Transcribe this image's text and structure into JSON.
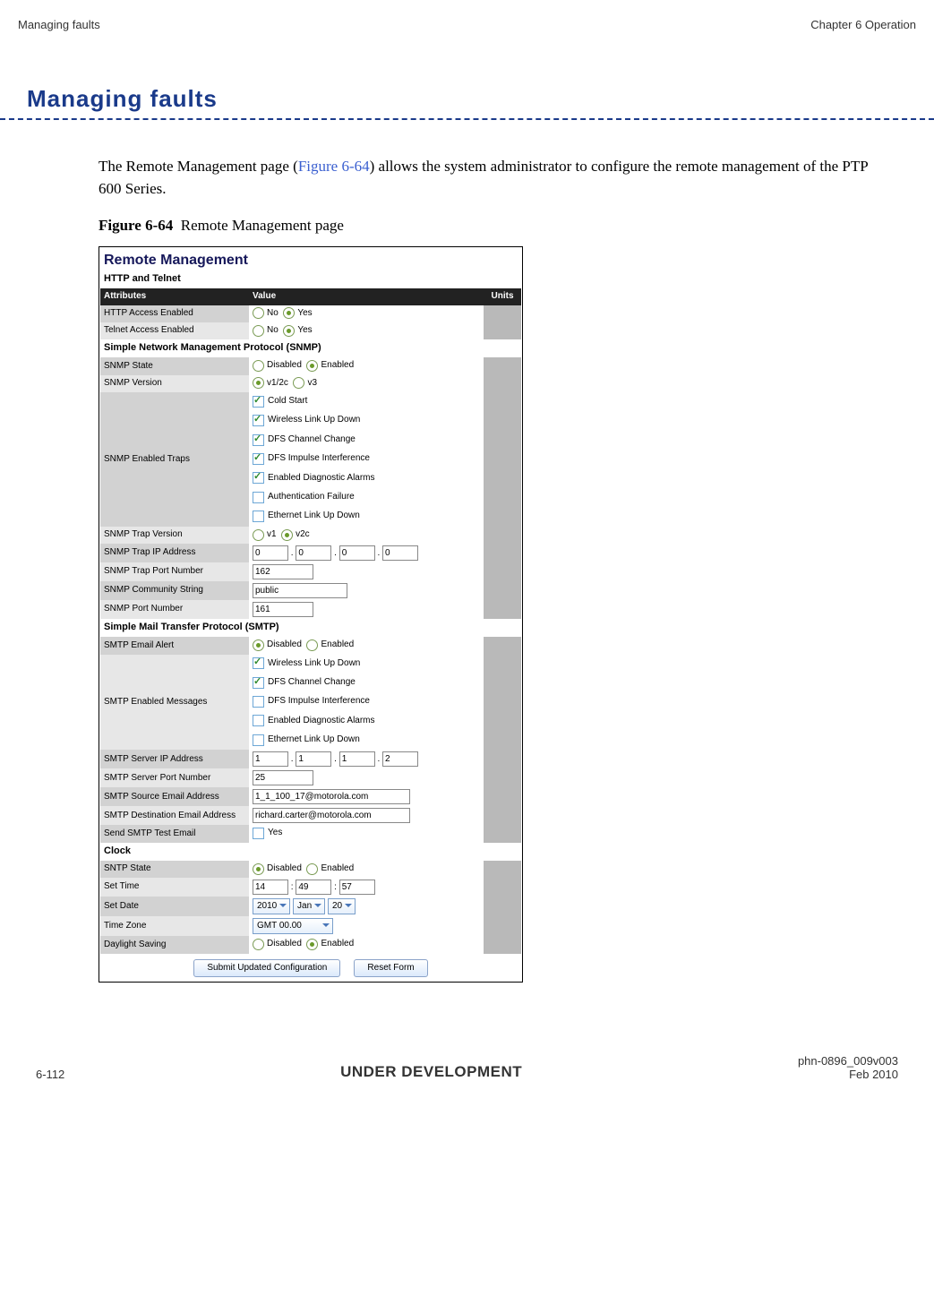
{
  "header": {
    "left": "Managing faults",
    "right": "Chapter 6 Operation"
  },
  "title": "Managing faults",
  "intro": {
    "part1": "The Remote Management page (",
    "figref": "Figure 6-64",
    "part2": ") allows the system administrator to configure the remote management of the PTP 600 Series."
  },
  "caption": {
    "label": "Figure 6-64",
    "text": "Remote Management page"
  },
  "figure": {
    "heading": "Remote Management",
    "sections": {
      "http": "HTTP and Telnet",
      "snmp": "Simple Network Management Protocol (SNMP)",
      "smtp": "Simple Mail Transfer Protocol (SMTP)",
      "clock": "Clock"
    },
    "colhead": {
      "attr": "Attributes",
      "val": "Value",
      "units": "Units"
    },
    "rows": {
      "http_access": {
        "label": "HTTP Access Enabled",
        "opt_no": "No",
        "opt_yes": "Yes"
      },
      "telnet_access": {
        "label": "Telnet Access Enabled",
        "opt_no": "No",
        "opt_yes": "Yes"
      },
      "snmp_state": {
        "label": "SNMP State",
        "opt_dis": "Disabled",
        "opt_en": "Enabled"
      },
      "snmp_version": {
        "label": "SNMP Version",
        "opt_v12c": "v1/2c",
        "opt_v3": "v3"
      },
      "snmp_traps": {
        "label": "SNMP Enabled Traps",
        "opts": {
          "cold": "Cold Start",
          "wlud": "Wireless Link Up Down",
          "dfscc": "DFS Channel Change",
          "dfsii": "DFS Impulse Interference",
          "eda": "Enabled Diagnostic Alarms",
          "authf": "Authentication Failure",
          "elud": "Ethernet Link Up Down"
        }
      },
      "snmp_trap_ver": {
        "label": "SNMP Trap Version",
        "opt_v1": "v1",
        "opt_v2c": "v2c"
      },
      "snmp_trap_ip": {
        "label": "SNMP Trap IP Address",
        "a": "0",
        "b": "0",
        "c": "0",
        "d": "0"
      },
      "snmp_trap_port": {
        "label": "SNMP Trap Port Number",
        "val": "162"
      },
      "snmp_comm": {
        "label": "SNMP Community String",
        "val": "public"
      },
      "snmp_port": {
        "label": "SNMP Port Number",
        "val": "161"
      },
      "smtp_alert": {
        "label": "SMTP Email Alert",
        "opt_dis": "Disabled",
        "opt_en": "Enabled"
      },
      "smtp_msgs": {
        "label": "SMTP Enabled Messages",
        "opts": {
          "wlud": "Wireless Link Up Down",
          "dfscc": "DFS Channel Change",
          "dfsii": "DFS Impulse Interference",
          "eda": "Enabled Diagnostic Alarms",
          "elud": "Ethernet Link Up Down"
        }
      },
      "smtp_ip": {
        "label": "SMTP Server IP Address",
        "a": "1",
        "b": "1",
        "c": "1",
        "d": "2"
      },
      "smtp_port": {
        "label": "SMTP Server Port Number",
        "val": "25"
      },
      "smtp_src": {
        "label": "SMTP Source Email Address",
        "val": "1_1_100_17@motorola.com"
      },
      "smtp_dst": {
        "label": "SMTP Destination Email Address",
        "val": "richard.carter@motorola.com"
      },
      "smtp_test": {
        "label": "Send SMTP Test Email",
        "opt": "Yes"
      },
      "sntp_state": {
        "label": "SNTP State",
        "opt_dis": "Disabled",
        "opt_en": "Enabled"
      },
      "set_time": {
        "label": "Set Time",
        "h": "14",
        "m": "49",
        "s": "57"
      },
      "set_date": {
        "label": "Set Date",
        "y": "2010",
        "mo": "Jan",
        "d": "20"
      },
      "tz": {
        "label": "Time Zone",
        "val": "GMT 00.00"
      },
      "dst": {
        "label": "Daylight Saving",
        "opt_dis": "Disabled",
        "opt_en": "Enabled"
      }
    },
    "buttons": {
      "submit": "Submit Updated Configuration",
      "reset": "Reset Form"
    }
  },
  "footer": {
    "left": "6-112",
    "center": "UNDER DEVELOPMENT",
    "doc": "phn-0896_009v003",
    "date": "Feb 2010"
  }
}
